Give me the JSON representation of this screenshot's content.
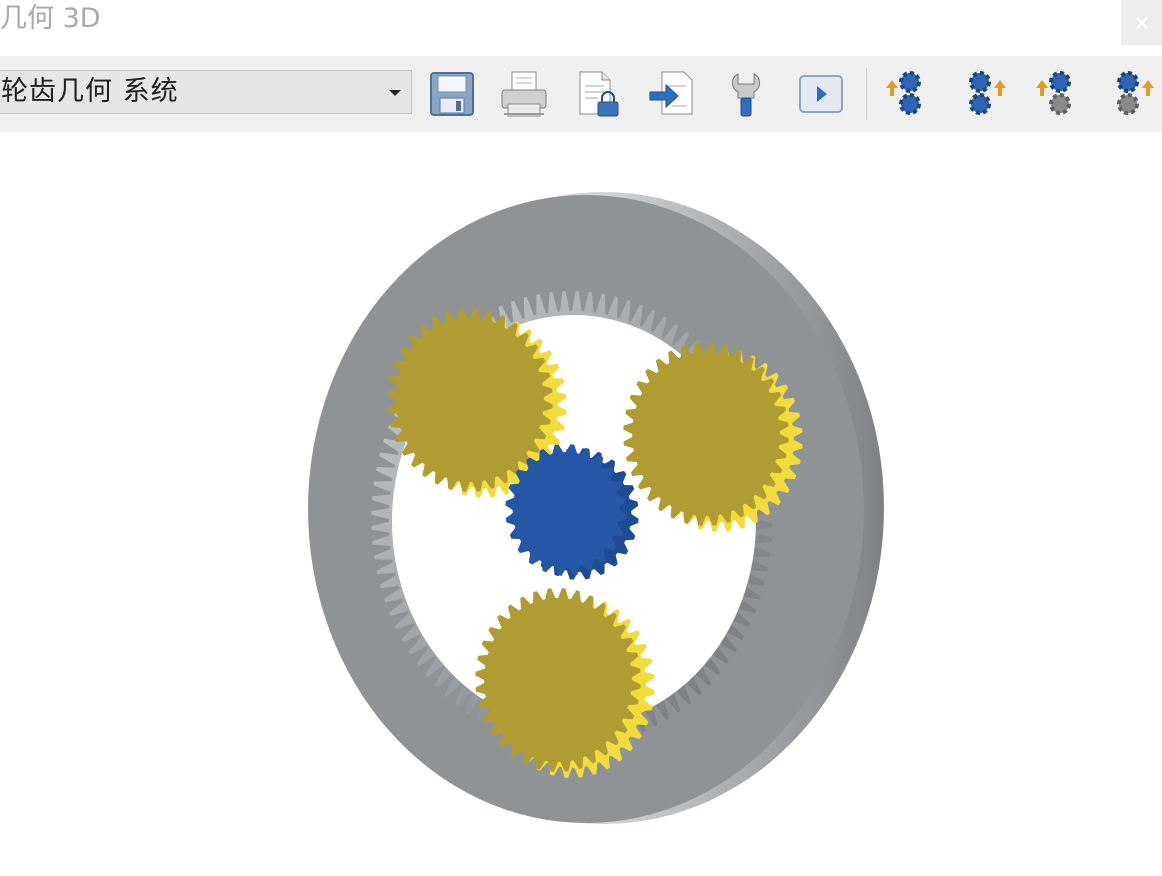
{
  "window": {
    "title": "几何 3D",
    "close_icon": "close-icon"
  },
  "toolbar": {
    "system_select": {
      "selected": "轮齿几何 系统"
    },
    "buttons": [
      {
        "id": "save",
        "icon": "save-icon"
      },
      {
        "id": "print",
        "icon": "printer-icon"
      },
      {
        "id": "export-document",
        "icon": "document-lock-icon"
      },
      {
        "id": "import",
        "icon": "import-arrow-icon"
      },
      {
        "id": "settings",
        "icon": "wrench-icon"
      },
      {
        "id": "animate",
        "icon": "play-icon"
      },
      {
        "id": "gear-view-1",
        "icon": "gears-arrow-icon"
      },
      {
        "id": "gear-view-2",
        "icon": "gears-arrow-icon"
      },
      {
        "id": "gear-view-3",
        "icon": "gears-arrow-icon"
      },
      {
        "id": "gear-view-4",
        "icon": "gears-arrow-icon"
      }
    ]
  },
  "model": {
    "type": "planetary gear set",
    "ring_gear": {
      "teeth": 96,
      "color": "#8f9396"
    },
    "sun_gear": {
      "teeth": 24,
      "color": "#2457a6"
    },
    "planet_gears": {
      "count": 3,
      "teeth": 36,
      "color": "#b09c32",
      "highlight": "#f0dc3c"
    }
  }
}
